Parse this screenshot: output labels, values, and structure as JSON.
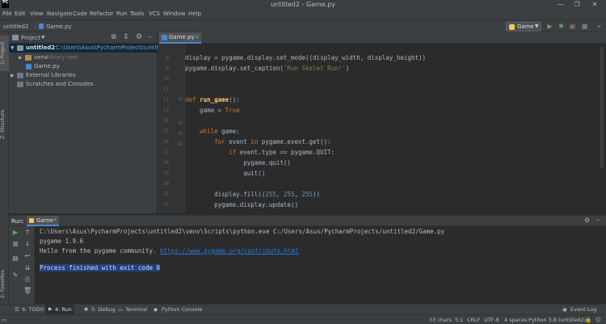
{
  "window": {
    "title": "untitled2 - Game.py",
    "logo_text": "PC",
    "controls": [
      "—",
      "❐",
      "✕"
    ]
  },
  "menu": [
    "File",
    "Edit",
    "View",
    "Navigate",
    "Code",
    "Refactor",
    "Run",
    "Tools",
    "VCS",
    "Window",
    "Help"
  ],
  "navbar": {
    "project": "untitled2",
    "file": "Game.py",
    "run_config": "Game"
  },
  "left_stripe": {
    "project_tab": "1: Project",
    "structure_tab": "Z: Structure",
    "favorites_tab": "2: Favorites"
  },
  "project_panel": {
    "title": "Project",
    "tree": [
      {
        "label": "untitled2",
        "detail": "C:\\Users\\Asus\\PycharmProjects\\untitled2",
        "depth": 0
      },
      {
        "label": "venv",
        "detail": "library root",
        "depth": 1
      },
      {
        "label": "Game.py",
        "detail": "",
        "depth": 1
      },
      {
        "label": "External Libraries",
        "detail": "",
        "depth": 0
      },
      {
        "label": "Scratches and Consoles",
        "detail": "",
        "depth": 0
      }
    ]
  },
  "editor": {
    "tab": "Game.py",
    "line_numbers": [
      "8",
      "9",
      "10",
      "11",
      "12",
      "13",
      "14",
      "15",
      "16",
      "17",
      "18",
      "19",
      "20",
      "21",
      "22",
      "23"
    ],
    "lines": {
      "l8": "display = pygame.display.set_mode((display_width, display_height))",
      "l9a": "pygame.display.set_caption(",
      "l9b": "'Run Skelet Run!'",
      "l9c": ")",
      "l12a": "def ",
      "l12b": "run_game",
      "l12c": "():",
      "l13a": "    game = ",
      "l13b": "True",
      "l15a": "    while ",
      "l15b": "game:",
      "l16a": "        for ",
      "l16b": "event ",
      "l16c": "in ",
      "l16d": "pygame.event.get():",
      "l17a": "            if ",
      "l17b": "event.type == pygame.QUIT:",
      "l18": "                pygame.quit()",
      "l19": "                quit()",
      "l21a": "        display.fill((",
      "l21b": "255",
      "l21c": ", ",
      "l21d": "255",
      "l21e": ", ",
      "l21f": "255",
      "l21g": "))",
      "l22": "        pygame.display.update()"
    }
  },
  "run_panel": {
    "label": "Run:",
    "tab": "Game",
    "output": [
      "C:\\Users\\Asus\\PycharmProjects\\untitled2\\venv\\Scripts\\python.exe C:/Users/Asus/PycharmProjects/untitled2/Game.py",
      "pygame 1.9.6",
      "Hello from the pygame community. ",
      "Process finished with exit code 0"
    ],
    "link": "https://www.pygame.org/contribute.html"
  },
  "tool_tabs": [
    "6: TODO",
    "4: Run",
    "5: Debug",
    "Terminal",
    "Python Console"
  ],
  "event_log": "Event Log",
  "status": {
    "chars": "33 chars",
    "position": "5:1",
    "line_sep": "CRLF",
    "encoding": "UTF-8",
    "indent": "4 spaces",
    "interpreter": "Python 3.8 (untitled2)"
  },
  "colors": {
    "keyword": "#cc7832",
    "string": "#6a8759",
    "number": "#6897bb",
    "function": "#ffc66d",
    "link": "#287bde",
    "selection": "#214283"
  }
}
